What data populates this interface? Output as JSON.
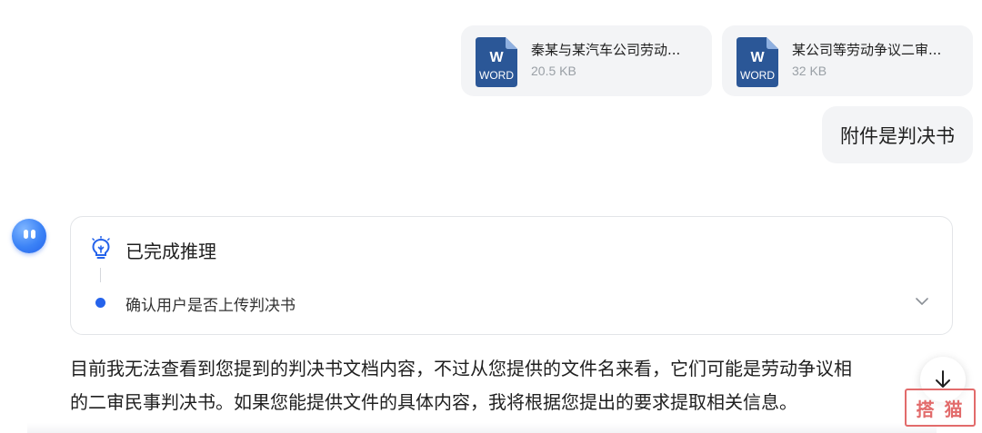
{
  "attachments": [
    {
      "name": "秦某与某汽车公司劳动...",
      "size": "20.5 KB",
      "icon_letter": "W",
      "icon_label": "WORD"
    },
    {
      "name": "某公司等劳动争议二审...",
      "size": "32 KB",
      "icon_letter": "W",
      "icon_label": "WORD"
    }
  ],
  "user_message": "附件是判决书",
  "reasoning": {
    "title": "已完成推理",
    "steps": [
      "确认用户是否上传判决书"
    ],
    "icon": "lightbulb-icon"
  },
  "answer_lines": [
    "目前我无法查看到您提到的判决书文档内容，不过从您提供的文件名来看，它们可能是劳动争议相",
    "的二审民事判决书。如果您能提供文件的具体内容，我将根据您提出的要求提取相关信息。"
  ],
  "watermark": "搭 猫",
  "colors": {
    "accent": "#2563eb",
    "word_icon": "#2b5797",
    "bubble_bg": "#f3f4f6"
  }
}
